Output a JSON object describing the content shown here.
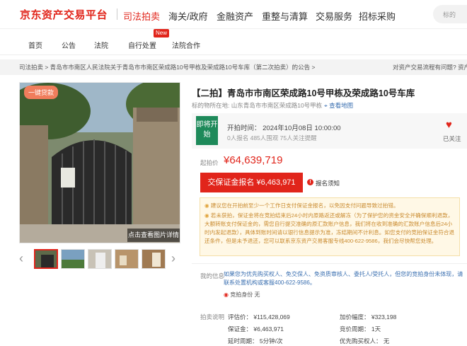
{
  "header": {
    "logo": "京东资产交易平台",
    "nav": [
      "司法拍卖",
      "海关/政府",
      "金融资产",
      "重整与清算",
      "交易服务",
      "招标采购"
    ],
    "search_placeholder": "标的"
  },
  "subnav": {
    "items": [
      "首页",
      "公告",
      "法院",
      "自行处置",
      "法院合作"
    ],
    "badge": "New"
  },
  "breadcrumb": {
    "path": "司法拍卖 > 青岛市市南区人民法院关于青岛市市南区荣成路10号甲栋及荣成路10号车库（第二次拍卖）的公告 > 标的物详情",
    "right": "对资产交易流程有问题? 资产"
  },
  "gallery": {
    "tag": "一键贷款",
    "detail_button": "点击查看图片详情",
    "prev_icon": "chevron-left-icon",
    "next_icon": "chevron-right-icon"
  },
  "listing": {
    "title": "【二拍】青岛市市南区荣成路10号甲栋及荣成路10号车库",
    "location": "标的物所在地:  山东青岛市市南区荣成路10号甲栋",
    "map_link": "查看地图",
    "status": "即将开始",
    "start_time": "开拍时间：  2024年10月08日 10:00:00",
    "counts": "0人报名   485人围观   75人关注提醒",
    "watch_label": "已关注",
    "price_label": "起拍价",
    "price": "¥64,639,719",
    "deposit_button": "交保证金报名 ¥6,463,971",
    "notice_link": "报名须知",
    "tips": [
      "建议您在开拍前至少一个工作日支付保证金报名，以免因支付问题导致过拍错。",
      "若未获拍，保证金将在竞拍结束后24小时内原路返还或解冻（为了保护您的资金安全并确保顺利退款，大额转账支付保证金的，需您自行提交准确的原汇款账户信息，我们将在收到准确的汇款账户信息后24小时内发起退款），具体到账时间请以银行信息提示为准，冻结期间不计利息。如您支付的竞拍保证金符合退还条件，但是未予退还，您可以联系京东资产交易客服专线400-622-9586，我们会尽快帮您处理。"
    ],
    "party_label": "我的信息",
    "party_text": "如果您为优先购买权人、免交保人、免资质审核人、委托人/受托人，但您的竞拍身份未体现，请联系处置机构或客服400-622-9586。",
    "qual": "竞拍身份   无",
    "rules_label": "拍卖说明",
    "rules": [
      {
        "label": "评估价：",
        "value": "¥115,428,069"
      },
      {
        "label": "加价幅度：",
        "value": "¥323,198"
      },
      {
        "label": "保证金：",
        "value": "¥6,463,971"
      },
      {
        "label": "竞价周期：",
        "value": "1天"
      },
      {
        "label": "延时周期：",
        "value": "5分钟/次"
      },
      {
        "label": "优先购买权人：",
        "value": "无"
      }
    ]
  }
}
